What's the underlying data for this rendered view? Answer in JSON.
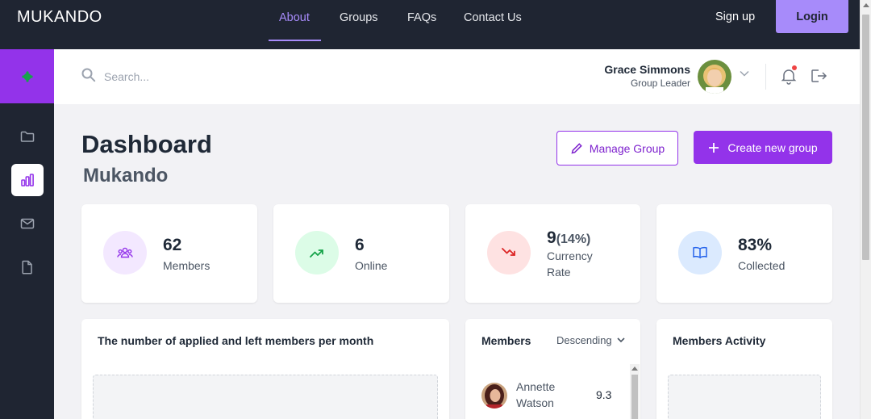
{
  "nav": {
    "brand": "MUKANDO",
    "links": [
      "About",
      "Groups",
      "FAQs",
      "Contact Us"
    ],
    "active_link": "About",
    "signup_label": "Sign up",
    "login_label": "Login"
  },
  "header": {
    "search_placeholder": "Search...",
    "user_name": "Grace Simmons",
    "user_role": "Group Leader"
  },
  "dashboard": {
    "title": "Dashboard",
    "group_name": "Mukando",
    "manage_label": "Manage Group",
    "create_label": "Create new group"
  },
  "stats": [
    {
      "value": "62",
      "extra": "",
      "label": "Members",
      "icon": "users-icon",
      "color": "#9333ea",
      "bg": "#f3e8ff"
    },
    {
      "value": "6",
      "extra": "",
      "label": "Online",
      "icon": "trending-up-icon",
      "color": "#16a34a",
      "bg": "#dcfce7"
    },
    {
      "value": "9",
      "extra": "(14%)",
      "label": "Currency Rate",
      "icon": "trending-down-icon",
      "color": "#dc2626",
      "bg": "#fee2e2"
    },
    {
      "value": "83%",
      "extra": "",
      "label": "Collected",
      "icon": "book-icon",
      "color": "#2563eb",
      "bg": "#dbeafe"
    }
  ],
  "panels": {
    "chart_title": "The number of applied and left members per month",
    "members_title": "Members",
    "sort_label": "Descending",
    "activity_title": "Members Activity"
  },
  "members": [
    {
      "name": "Annette Watson",
      "score": "9.3"
    }
  ],
  "colors": {
    "dark": "#1f2532",
    "accent": "#9333ea",
    "accent_light": "#a78bfa"
  }
}
